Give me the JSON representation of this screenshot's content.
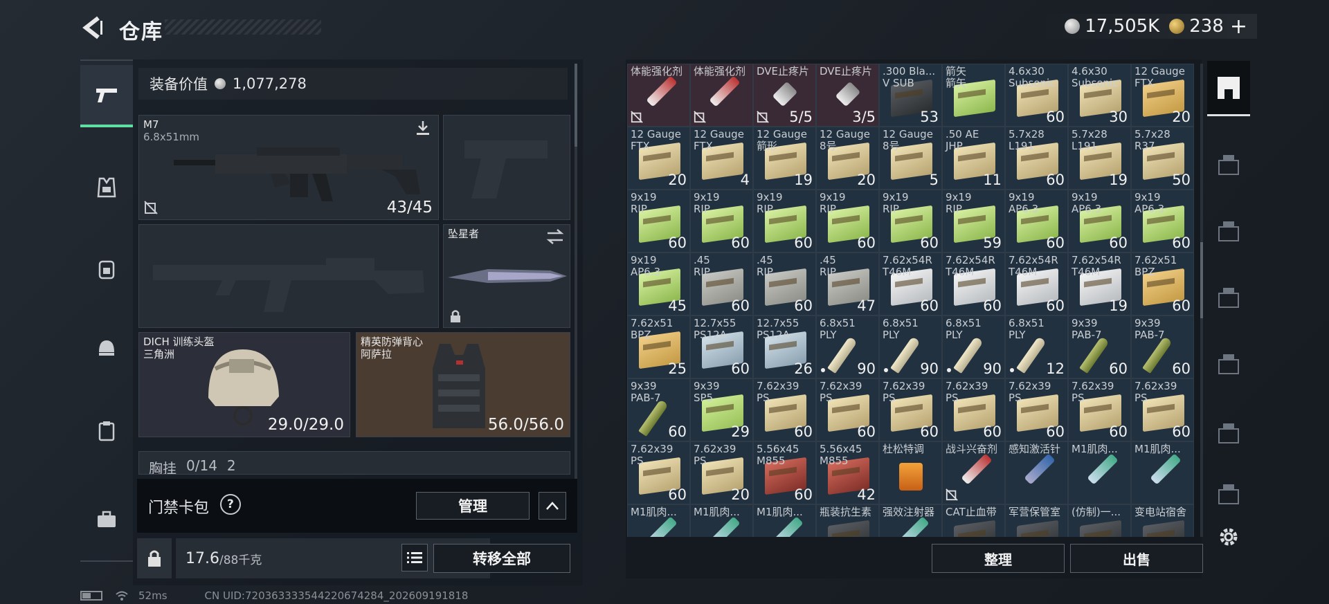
{
  "header": {
    "title": "仓库",
    "silver": "17,505K",
    "gold": "238"
  },
  "loadout": {
    "value_label": "装备价值",
    "value": "1,077,278",
    "primary": {
      "name": "M7",
      "caliber": "6.8x51mm",
      "ammo": "43/45"
    },
    "melee": {
      "name": "坠星者"
    },
    "helmet": {
      "name": "DICH 训练头盔",
      "origin": "三角洲",
      "durability": "29.0/29.0"
    },
    "armor": {
      "name": "精英防弹背心",
      "origin": "阿萨拉",
      "durability": "56.0/56.0"
    },
    "chest": {
      "label": "胸挂",
      "value": "0/14",
      "suffix": "2"
    },
    "access": {
      "label": "门禁卡包",
      "help": "?",
      "manage": "管理"
    },
    "weight": {
      "current": "17.6",
      "max": "/88千克"
    },
    "transfer": "转移全部"
  },
  "stash": {
    "sort": "整理",
    "sell": "出售",
    "rows": [
      [
        {
          "n": "体能强化剂",
          "c": "",
          "t": "syr-red",
          "bg": "red",
          "nd": true
        },
        {
          "n": "体能强化剂",
          "c": "",
          "t": "syr-red",
          "bg": "red",
          "nd": true
        },
        {
          "n": "DVE止疼片",
          "c": "5/5",
          "t": "pill",
          "bg": "red",
          "nd": true
        },
        {
          "n": "DVE止疼片",
          "c": "3/5",
          "t": "pill",
          "bg": "red"
        },
        {
          "n": ".300 Bla...",
          "n2": "V SUB",
          "c": "53",
          "t": "dark"
        },
        {
          "n": "箭矢",
          "n2": "箭矢",
          "c": "",
          "t": "green"
        },
        {
          "n": "4.6x30",
          "n2": "Subsonic",
          "c": "60",
          "t": "tan"
        },
        {
          "n": "4.6x30",
          "n2": "Subsonic",
          "c": "30",
          "t": "tan"
        },
        {
          "n": "12 Gauge",
          "n2": "FTX",
          "c": "20",
          "t": "orange"
        }
      ],
      [
        {
          "n": "12 Gauge",
          "n2": "FTX",
          "c": "20",
          "t": "tan"
        },
        {
          "n": "12 Gauge",
          "n2": "FTX",
          "c": "4",
          "t": "tan"
        },
        {
          "n": "12 Gauge",
          "n2": "箭形",
          "c": "19",
          "t": "tan"
        },
        {
          "n": "12 Gauge",
          "n2": "8号",
          "c": "20",
          "t": "tan"
        },
        {
          "n": "12 Gauge",
          "n2": "8号",
          "c": "5",
          "t": "tan"
        },
        {
          "n": ".50 AE",
          "n2": "JHP",
          "c": "11",
          "t": "tan"
        },
        {
          "n": "5.7x28",
          "n2": "L191",
          "c": "60",
          "t": "tan"
        },
        {
          "n": "5.7x28",
          "n2": "L191",
          "c": "19",
          "t": "tan"
        },
        {
          "n": "5.7x28",
          "n2": "R37",
          "c": "50",
          "t": "tan"
        }
      ],
      [
        {
          "n": "9x19",
          "n2": "RIP",
          "c": "60",
          "t": "green"
        },
        {
          "n": "9x19",
          "n2": "RIP",
          "c": "60",
          "t": "green"
        },
        {
          "n": "9x19",
          "n2": "RIP",
          "c": "60",
          "t": "green"
        },
        {
          "n": "9x19",
          "n2": "RIP",
          "c": "60",
          "t": "green"
        },
        {
          "n": "9x19",
          "n2": "RIP",
          "c": "60",
          "t": "green"
        },
        {
          "n": "9x19",
          "n2": "RIP",
          "c": "59",
          "t": "green"
        },
        {
          "n": "9x19",
          "n2": "AP6.3",
          "c": "60",
          "t": "green"
        },
        {
          "n": "9x19",
          "n2": "AP6.3",
          "c": "60",
          "t": "green"
        },
        {
          "n": "9x19",
          "n2": "AP6.3",
          "c": "60",
          "t": "green"
        }
      ],
      [
        {
          "n": "9x19",
          "n2": "AP6.3",
          "c": "45",
          "t": "green"
        },
        {
          "n": ".45",
          "n2": "RIP",
          "c": "60",
          "t": "grey"
        },
        {
          "n": ".45",
          "n2": "RIP",
          "c": "60",
          "t": "grey"
        },
        {
          "n": ".45",
          "n2": "RIP",
          "c": "47",
          "t": "grey"
        },
        {
          "n": "7.62x54R",
          "n2": "T46M",
          "c": "60",
          "t": "white"
        },
        {
          "n": "7.62x54R",
          "n2": "T46M",
          "c": "60",
          "t": "white"
        },
        {
          "n": "7.62x54R",
          "n2": "T46M",
          "c": "60",
          "t": "white"
        },
        {
          "n": "7.62x54R",
          "n2": "T46M",
          "c": "19",
          "t": "white"
        },
        {
          "n": "7.62x51",
          "n2": "BPZ",
          "c": "60",
          "t": "orange"
        }
      ],
      [
        {
          "n": "7.62x51",
          "n2": "BPZ",
          "c": "25",
          "t": "orange"
        },
        {
          "n": "12.7x55",
          "n2": "PS12A",
          "c": "60",
          "t": "blue"
        },
        {
          "n": "12.7x55",
          "n2": "PS12A",
          "c": "26",
          "t": "blue"
        },
        {
          "n": "6.8x51",
          "n2": "PLY",
          "c": "90",
          "t": "bullet",
          "dot": true
        },
        {
          "n": "6.8x51",
          "n2": "PLY",
          "c": "90",
          "t": "bullet",
          "dot": true
        },
        {
          "n": "6.8x51",
          "n2": "PLY",
          "c": "90",
          "t": "bullet",
          "dot": true
        },
        {
          "n": "6.8x51",
          "n2": "PLY",
          "c": "12",
          "t": "bullet",
          "dot": true
        },
        {
          "n": "9x39",
          "n2": "PAB-7",
          "c": "60",
          "t": "bulletg"
        },
        {
          "n": "9x39",
          "n2": "PAB-7",
          "c": "60",
          "t": "bulletg"
        }
      ],
      [
        {
          "n": "9x39",
          "n2": "PAB-7",
          "c": "60",
          "t": "bulletg"
        },
        {
          "n": "9x39",
          "n2": "SP5",
          "c": "29",
          "t": "lime"
        },
        {
          "n": "7.62x39",
          "n2": "PS",
          "c": "60",
          "t": "tan"
        },
        {
          "n": "7.62x39",
          "n2": "PS",
          "c": "60",
          "t": "tan"
        },
        {
          "n": "7.62x39",
          "n2": "PS",
          "c": "60",
          "t": "tan"
        },
        {
          "n": "7.62x39",
          "n2": "PS",
          "c": "60",
          "t": "tan"
        },
        {
          "n": "7.62x39",
          "n2": "PS",
          "c": "60",
          "t": "tan"
        },
        {
          "n": "7.62x39",
          "n2": "PS",
          "c": "60",
          "t": "tan"
        },
        {
          "n": "7.62x39",
          "n2": "PS",
          "c": "60",
          "t": "tan"
        }
      ],
      [
        {
          "n": "7.62x39",
          "n2": "PS",
          "c": "60",
          "t": "tan"
        },
        {
          "n": "7.62x39",
          "n2": "PS",
          "c": "20",
          "t": "tan"
        },
        {
          "n": "5.56x45",
          "n2": "M855",
          "c": "60",
          "t": "red"
        },
        {
          "n": "5.56x45",
          "n2": "M855",
          "c": "42",
          "t": "red"
        },
        {
          "n": "杜松特调",
          "c": "",
          "t": "drink"
        },
        {
          "n": "战斗兴奋剂",
          "c": "",
          "t": "syr-red",
          "nd": true
        },
        {
          "n": "感知激活针",
          "c": "",
          "t": "syr-blue"
        },
        {
          "n": "M1肌肉...",
          "c": "",
          "t": "syr-green"
        },
        {
          "n": "M1肌肉...",
          "c": "",
          "t": "syr-green"
        }
      ],
      [
        {
          "n": "M1肌肉...",
          "c": "",
          "t": "syr-green"
        },
        {
          "n": "M1肌肉...",
          "c": "",
          "t": "syr-green"
        },
        {
          "n": "M1肌肉...",
          "c": "",
          "t": "syr-green"
        },
        {
          "n": "瓶装抗生素",
          "c": "",
          "t": "dark"
        },
        {
          "n": "强效注射器",
          "c": "",
          "t": "syr-green"
        },
        {
          "n": "CAT止血带",
          "c": "",
          "t": "dark"
        },
        {
          "n": "军营保管室",
          "c": "",
          "t": "dark"
        },
        {
          "n": "(仿制)一...",
          "c": "",
          "t": "dark"
        },
        {
          "n": "变电站宿舍",
          "c": "",
          "t": "dark"
        }
      ]
    ]
  },
  "status": {
    "ping": "52ms",
    "uid": "CN UID:7203633335442206742​84_202609191818"
  }
}
